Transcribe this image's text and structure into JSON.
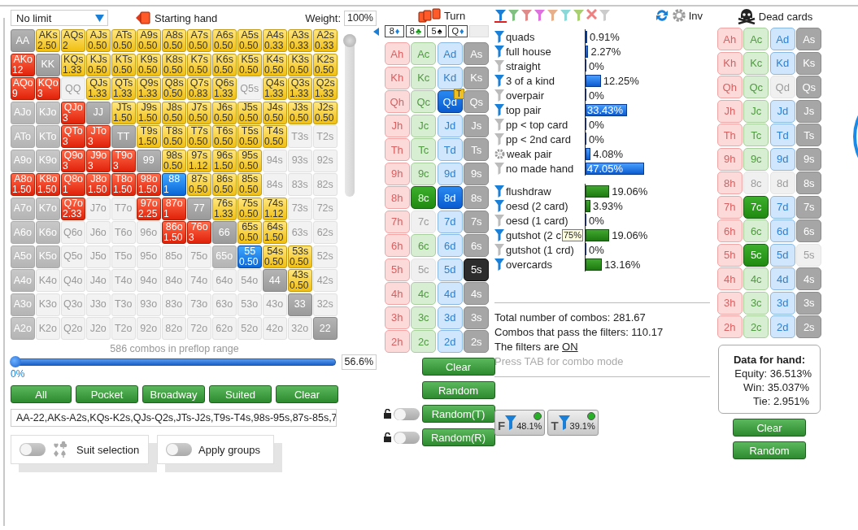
{
  "range_panel": {
    "game_dropdown": "No limit",
    "starting_hand_label": "Starting hand",
    "weight_label": "Weight:",
    "weight_value": "100%",
    "weight_slider": {
      "level": 1
    }
  },
  "matrix": {
    "rows": [
      [
        {
          "label": "AA",
          "kind": "pair"
        },
        {
          "label": "AKs",
          "weight": "2.50",
          "kind": "suited"
        },
        {
          "label": "AQs",
          "weight": "2",
          "kind": "suited"
        },
        {
          "label": "AJs",
          "weight": "0.50",
          "kind": "suited"
        },
        {
          "label": "ATs",
          "weight": "0.50",
          "kind": "suited"
        },
        {
          "label": "A9s",
          "weight": "0.50",
          "kind": "suited"
        },
        {
          "label": "A8s",
          "weight": "0.50",
          "kind": "suited"
        },
        {
          "label": "A7s",
          "weight": "0.50",
          "kind": "suited"
        },
        {
          "label": "A6s",
          "weight": "0.50",
          "kind": "suited"
        },
        {
          "label": "A5s",
          "weight": "0.50",
          "kind": "suited"
        },
        {
          "label": "A4s",
          "weight": "0.33",
          "kind": "suited"
        },
        {
          "label": "A3s",
          "weight": "0.33",
          "kind": "suited"
        },
        {
          "label": "A2s",
          "weight": "0.33",
          "kind": "suited"
        }
      ],
      [
        {
          "label": "AKo",
          "weight": "12",
          "kind": "offsuit"
        },
        {
          "label": "KK",
          "kind": "pair"
        },
        {
          "label": "KQs",
          "weight": "1.33",
          "kind": "suited"
        },
        {
          "label": "KJs",
          "weight": "0.50",
          "kind": "suited"
        },
        {
          "label": "KTs",
          "weight": "0.50",
          "kind": "suited"
        },
        {
          "label": "K9s",
          "weight": "0.50",
          "kind": "suited"
        },
        {
          "label": "K8s",
          "weight": "0.50",
          "kind": "suited"
        },
        {
          "label": "K7s",
          "weight": "0.50",
          "kind": "suited"
        },
        {
          "label": "K6s",
          "weight": "0.50",
          "kind": "suited"
        },
        {
          "label": "K5s",
          "weight": "0.50",
          "kind": "suited"
        },
        {
          "label": "K4s",
          "weight": "0.50",
          "kind": "suited"
        },
        {
          "label": "K3s",
          "weight": "0.50",
          "kind": "suited"
        },
        {
          "label": "K2s",
          "weight": "0.50",
          "kind": "suited"
        }
      ],
      [
        {
          "label": "AQo",
          "weight": "9",
          "kind": "offsuit"
        },
        {
          "label": "KQo",
          "weight": "3",
          "kind": "offsuit"
        },
        {
          "label": "QQ",
          "kind": "empty"
        },
        {
          "label": "QJs",
          "weight": "1.33",
          "kind": "suited"
        },
        {
          "label": "QTs",
          "weight": "1.33",
          "kind": "suited"
        },
        {
          "label": "Q9s",
          "weight": "1.33",
          "kind": "suited"
        },
        {
          "label": "Q8s",
          "weight": "0.50",
          "kind": "suited"
        },
        {
          "label": "Q7s",
          "weight": "0.83",
          "kind": "suited"
        },
        {
          "label": "Q6s",
          "weight": "1.33",
          "kind": "suited"
        },
        {
          "label": "Q5s",
          "kind": "empty"
        },
        {
          "label": "Q4s",
          "weight": "1.33",
          "kind": "suited"
        },
        {
          "label": "Q3s",
          "weight": "1.33",
          "kind": "suited"
        },
        {
          "label": "Q2s",
          "weight": "1.33",
          "kind": "suited"
        }
      ],
      [
        {
          "label": "AJo",
          "kind": "gray"
        },
        {
          "label": "KJo",
          "kind": "gray"
        },
        {
          "label": "QJo",
          "weight": "3",
          "kind": "offsuit"
        },
        {
          "label": "JJ",
          "kind": "pair"
        },
        {
          "label": "JTs",
          "weight": "1.50",
          "kind": "suited"
        },
        {
          "label": "J9s",
          "weight": "1.50",
          "kind": "suited"
        },
        {
          "label": "J8s",
          "weight": "0.50",
          "kind": "suited"
        },
        {
          "label": "J7s",
          "weight": "0.50",
          "kind": "suited"
        },
        {
          "label": "J6s",
          "weight": "0.50",
          "kind": "suited"
        },
        {
          "label": "J5s",
          "weight": "0.50",
          "kind": "suited"
        },
        {
          "label": "J4s",
          "weight": "0.50",
          "kind": "suited"
        },
        {
          "label": "J3s",
          "weight": "0.50",
          "kind": "suited"
        },
        {
          "label": "J2s",
          "weight": "0.50",
          "kind": "suited"
        }
      ],
      [
        {
          "label": "ATo",
          "kind": "gray"
        },
        {
          "label": "KTo",
          "kind": "gray"
        },
        {
          "label": "QTo",
          "weight": "3",
          "kind": "offsuit"
        },
        {
          "label": "JTo",
          "weight": "3",
          "kind": "offsuit"
        },
        {
          "label": "TT",
          "kind": "pair"
        },
        {
          "label": "T9s",
          "weight": "1.50",
          "kind": "suited"
        },
        {
          "label": "T8s",
          "weight": "0.50",
          "kind": "suited"
        },
        {
          "label": "T7s",
          "weight": "0.50",
          "kind": "suited"
        },
        {
          "label": "T6s",
          "weight": "0.50",
          "kind": "suited"
        },
        {
          "label": "T5s",
          "weight": "0.50",
          "kind": "suited"
        },
        {
          "label": "T4s",
          "weight": "0.50",
          "kind": "suited"
        },
        {
          "label": "T3s",
          "kind": "empty"
        },
        {
          "label": "T2s",
          "kind": "empty"
        }
      ],
      [
        {
          "label": "A9o",
          "kind": "gray"
        },
        {
          "label": "K9o",
          "kind": "gray"
        },
        {
          "label": "Q9o",
          "weight": "3",
          "kind": "offsuit"
        },
        {
          "label": "J9o",
          "weight": "3",
          "kind": "offsuit"
        },
        {
          "label": "T9o",
          "weight": "3",
          "kind": "offsuit"
        },
        {
          "label": "99",
          "kind": "pair"
        },
        {
          "label": "98s",
          "weight": "0.50",
          "kind": "suited"
        },
        {
          "label": "97s",
          "weight": "1.12",
          "kind": "suited"
        },
        {
          "label": "96s",
          "weight": "1.50",
          "kind": "suited"
        },
        {
          "label": "95s",
          "weight": "0.50",
          "kind": "suited"
        },
        {
          "label": "94s",
          "kind": "empty"
        },
        {
          "label": "93s",
          "kind": "empty"
        },
        {
          "label": "92s",
          "kind": "empty"
        }
      ],
      [
        {
          "label": "A8o",
          "weight": "1.50",
          "kind": "offsuit"
        },
        {
          "label": "K8o",
          "weight": "1.50",
          "kind": "offsuit"
        },
        {
          "label": "Q8o",
          "weight": "1",
          "kind": "offsuit"
        },
        {
          "label": "J8o",
          "weight": "1.50",
          "kind": "offsuit"
        },
        {
          "label": "T8o",
          "weight": "1.50",
          "kind": "offsuit"
        },
        {
          "label": "98o",
          "weight": "1.50",
          "kind": "offsuit"
        },
        {
          "label": "88",
          "weight": "1",
          "kind": "blue"
        },
        {
          "label": "87s",
          "weight": "0.50",
          "kind": "suited"
        },
        {
          "label": "86s",
          "weight": "0.50",
          "kind": "suited"
        },
        {
          "label": "85s",
          "weight": "0.50",
          "kind": "suited"
        },
        {
          "label": "84s",
          "kind": "empty"
        },
        {
          "label": "83s",
          "kind": "empty"
        },
        {
          "label": "82s",
          "kind": "empty"
        }
      ],
      [
        {
          "label": "A7o",
          "kind": "gray"
        },
        {
          "label": "K7o",
          "kind": "gray"
        },
        {
          "label": "Q7o",
          "weight": "2.33",
          "kind": "offsuit"
        },
        {
          "label": "J7o",
          "kind": "empty"
        },
        {
          "label": "T7o",
          "kind": "empty"
        },
        {
          "label": "97o",
          "weight": "2.25",
          "kind": "offsuit"
        },
        {
          "label": "87o",
          "weight": "1",
          "kind": "offsuit"
        },
        {
          "label": "77",
          "kind": "pair"
        },
        {
          "label": "76s",
          "weight": "1.33",
          "kind": "suited"
        },
        {
          "label": "75s",
          "weight": "0.50",
          "kind": "suited"
        },
        {
          "label": "74s",
          "weight": "1.12",
          "kind": "suited"
        },
        {
          "label": "73s",
          "kind": "empty"
        },
        {
          "label": "72s",
          "kind": "empty"
        }
      ],
      [
        {
          "label": "A6o",
          "kind": "gray"
        },
        {
          "label": "K6o",
          "kind": "gray"
        },
        {
          "label": "Q6o",
          "kind": "empty"
        },
        {
          "label": "J6o",
          "kind": "empty"
        },
        {
          "label": "T6o",
          "kind": "empty"
        },
        {
          "label": "96o",
          "kind": "empty"
        },
        {
          "label": "86o",
          "weight": "1.50",
          "kind": "offsuit"
        },
        {
          "label": "76o",
          "weight": "3",
          "kind": "offsuit"
        },
        {
          "label": "66",
          "kind": "pair"
        },
        {
          "label": "65s",
          "weight": "0.50",
          "kind": "suited"
        },
        {
          "label": "64s",
          "weight": "1.50",
          "kind": "suited"
        },
        {
          "label": "63s",
          "kind": "empty"
        },
        {
          "label": "62s",
          "kind": "empty"
        }
      ],
      [
        {
          "label": "A5o",
          "kind": "gray"
        },
        {
          "label": "K5o",
          "kind": "gray"
        },
        {
          "label": "Q5o",
          "kind": "empty"
        },
        {
          "label": "J5o",
          "kind": "empty"
        },
        {
          "label": "T5o",
          "kind": "empty"
        },
        {
          "label": "95o",
          "kind": "empty"
        },
        {
          "label": "85o",
          "kind": "empty"
        },
        {
          "label": "75o",
          "kind": "empty"
        },
        {
          "label": "65o",
          "kind": "gray"
        },
        {
          "label": "55",
          "weight": "0.50",
          "kind": "blue"
        },
        {
          "label": "54s",
          "weight": "0.50",
          "kind": "suited"
        },
        {
          "label": "53s",
          "weight": "0.50",
          "kind": "suited"
        },
        {
          "label": "52s",
          "kind": "empty"
        }
      ],
      [
        {
          "label": "A4o",
          "kind": "gray"
        },
        {
          "label": "K4o",
          "kind": "empty"
        },
        {
          "label": "Q4o",
          "kind": "empty"
        },
        {
          "label": "J4o",
          "kind": "empty"
        },
        {
          "label": "T4o",
          "kind": "empty"
        },
        {
          "label": "94o",
          "kind": "empty"
        },
        {
          "label": "84o",
          "kind": "empty"
        },
        {
          "label": "74o",
          "kind": "empty"
        },
        {
          "label": "64o",
          "kind": "empty"
        },
        {
          "label": "54o",
          "kind": "empty"
        },
        {
          "label": "44",
          "kind": "pair"
        },
        {
          "label": "43s",
          "weight": "0.50",
          "kind": "suited"
        },
        {
          "label": "42s",
          "kind": "empty"
        }
      ],
      [
        {
          "label": "A3o",
          "kind": "gray"
        },
        {
          "label": "K3o",
          "kind": "empty"
        },
        {
          "label": "Q3o",
          "kind": "empty"
        },
        {
          "label": "J3o",
          "kind": "empty"
        },
        {
          "label": "T3o",
          "kind": "empty"
        },
        {
          "label": "93o",
          "kind": "empty"
        },
        {
          "label": "83o",
          "kind": "empty"
        },
        {
          "label": "73o",
          "kind": "empty"
        },
        {
          "label": "63o",
          "kind": "empty"
        },
        {
          "label": "53o",
          "kind": "empty"
        },
        {
          "label": "43o",
          "kind": "empty"
        },
        {
          "label": "33",
          "kind": "pair"
        },
        {
          "label": "32s",
          "kind": "empty"
        }
      ],
      [
        {
          "label": "A2o",
          "kind": "gray"
        },
        {
          "label": "K2o",
          "kind": "empty"
        },
        {
          "label": "Q2o",
          "kind": "empty"
        },
        {
          "label": "J2o",
          "kind": "empty"
        },
        {
          "label": "T2o",
          "kind": "empty"
        },
        {
          "label": "92o",
          "kind": "empty"
        },
        {
          "label": "82o",
          "kind": "empty"
        },
        {
          "label": "72o",
          "kind": "empty"
        },
        {
          "label": "62o",
          "kind": "empty"
        },
        {
          "label": "52o",
          "kind": "empty"
        },
        {
          "label": "42o",
          "kind": "empty"
        },
        {
          "label": "32o",
          "kind": "empty"
        },
        {
          "label": "22",
          "kind": "pair"
        }
      ]
    ]
  },
  "range_footer": {
    "combos_text": "586 combos in preflop range",
    "range_slider": {
      "level": 0
    },
    "slider_min": "0%",
    "slider_value": "56.6%",
    "buttons": [
      "All",
      "Pocket",
      "Broadway",
      "Suited",
      "Clear"
    ],
    "range_text": "AA-22,AKs-A2s,KQs-K2s,QJs-Q2s,JTs-J2s,T9s-T4s,98s-95s,87s-85s,7",
    "toggles": [
      {
        "label": "Suit selection",
        "on": false,
        "kind": "suits"
      },
      {
        "label": "Apply groups",
        "on": false,
        "kind": "plain"
      }
    ]
  },
  "board": {
    "title": "Turn",
    "slots": [
      {
        "kind": "card",
        "rank": "8",
        "suit": "♦",
        "color": "#1a7fd6"
      },
      {
        "kind": "card",
        "rank": "8",
        "suit": "♣",
        "color": "#1a9a1a"
      },
      {
        "kind": "card",
        "rank": "5",
        "suit": "♠",
        "color": "#111111"
      },
      {
        "kind": "card",
        "rank": "Q",
        "suit": "♦",
        "color": "#1a7fd6"
      },
      {
        "kind": "empty"
      }
    ],
    "cards": [
      [
        {
          "label": "Ah",
          "kind": "normal"
        },
        {
          "label": "Ac",
          "kind": "normal"
        },
        {
          "label": "Ad",
          "kind": "normal"
        },
        {
          "label": "As",
          "kind": "normal"
        }
      ],
      [
        {
          "label": "Kh",
          "kind": "normal"
        },
        {
          "label": "Kc",
          "kind": "normal"
        },
        {
          "label": "Kd",
          "kind": "normal"
        },
        {
          "label": "Ks",
          "kind": "normal"
        }
      ],
      [
        {
          "label": "Qh",
          "kind": "normal"
        },
        {
          "label": "Qc",
          "kind": "normal"
        },
        {
          "label": "Qd",
          "kind": "selected",
          "badge": "T"
        },
        {
          "label": "Qs",
          "kind": "normal"
        }
      ],
      [
        {
          "label": "Jh",
          "kind": "normal"
        },
        {
          "label": "Jc",
          "kind": "normal"
        },
        {
          "label": "Jd",
          "kind": "normal"
        },
        {
          "label": "Js",
          "kind": "normal"
        }
      ],
      [
        {
          "label": "Th",
          "kind": "normal"
        },
        {
          "label": "Tc",
          "kind": "normal"
        },
        {
          "label": "Td",
          "kind": "normal"
        },
        {
          "label": "Ts",
          "kind": "normal"
        }
      ],
      [
        {
          "label": "9h",
          "kind": "normal"
        },
        {
          "label": "9c",
          "kind": "normal"
        },
        {
          "label": "9d",
          "kind": "normal"
        },
        {
          "label": "9s",
          "kind": "normal"
        }
      ],
      [
        {
          "label": "8h",
          "kind": "normal"
        },
        {
          "label": "8c",
          "kind": "selected"
        },
        {
          "label": "8d",
          "kind": "selected"
        },
        {
          "label": "8s",
          "kind": "normal"
        }
      ],
      [
        {
          "label": "7h",
          "kind": "normal"
        },
        {
          "label": "7c",
          "kind": "used"
        },
        {
          "label": "7d",
          "kind": "normal"
        },
        {
          "label": "7s",
          "kind": "normal"
        }
      ],
      [
        {
          "label": "6h",
          "kind": "normal"
        },
        {
          "label": "6c",
          "kind": "normal"
        },
        {
          "label": "6d",
          "kind": "normal"
        },
        {
          "label": "6s",
          "kind": "normal"
        }
      ],
      [
        {
          "label": "5h",
          "kind": "normal"
        },
        {
          "label": "5c",
          "kind": "used"
        },
        {
          "label": "5d",
          "kind": "normal"
        },
        {
          "label": "5s",
          "kind": "selected"
        }
      ],
      [
        {
          "label": "4h",
          "kind": "normal"
        },
        {
          "label": "4c",
          "kind": "normal"
        },
        {
          "label": "4d",
          "kind": "normal"
        },
        {
          "label": "4s",
          "kind": "normal"
        }
      ],
      [
        {
          "label": "3h",
          "kind": "normal"
        },
        {
          "label": "3c",
          "kind": "normal"
        },
        {
          "label": "3d",
          "kind": "normal"
        },
        {
          "label": "3s",
          "kind": "normal"
        }
      ],
      [
        {
          "label": "2h",
          "kind": "normal"
        },
        {
          "label": "2c",
          "kind": "normal"
        },
        {
          "label": "2d",
          "kind": "normal"
        },
        {
          "label": "2s",
          "kind": "normal"
        }
      ]
    ],
    "buttons": [
      {
        "label": "Clear",
        "kind": "plain"
      },
      {
        "label": "Random",
        "kind": "plain"
      },
      {
        "label": "Random(T)",
        "kind": "lock",
        "on": false
      },
      {
        "label": "Random(R)",
        "kind": "lock",
        "on": false
      }
    ]
  },
  "stats": {
    "filter_tabs": [
      {
        "kind": "funnel",
        "color": "#1a7fd6",
        "selected": true
      },
      {
        "kind": "funnel",
        "color": "#80c080",
        "selected": false
      },
      {
        "kind": "funnel",
        "color": "#e08a8a",
        "selected": false
      },
      {
        "kind": "funnel",
        "color": "#e070e0",
        "selected": false
      },
      {
        "kind": "funnel",
        "color": "#e8b08a",
        "selected": false
      },
      {
        "kind": "funnel",
        "color": "#8ad8d8",
        "selected": false
      },
      {
        "kind": "funnel",
        "color": "#a8d070",
        "selected": false
      },
      {
        "kind": "clear",
        "color": "#f08080",
        "selected": false
      },
      {
        "kind": "funnel",
        "color": "#cccccc",
        "selected": false
      }
    ],
    "inv_label": "Inv",
    "made_hands": [
      {
        "kind": "filter",
        "on": true,
        "label": "quads",
        "level": 0.0091,
        "reading": "0.91%"
      },
      {
        "kind": "filter",
        "on": true,
        "label": "full house",
        "level": 0.0227,
        "reading": "2.27%"
      },
      {
        "kind": "filter",
        "on": false,
        "label": "straight",
        "level": 0,
        "reading": "0%"
      },
      {
        "kind": "filter",
        "on": true,
        "label": "3 of a kind",
        "level": 0.1225,
        "reading": "12.25%"
      },
      {
        "kind": "filter",
        "on": false,
        "label": "overpair",
        "level": 0,
        "reading": "0%"
      },
      {
        "kind": "filter",
        "on": true,
        "label": "top pair",
        "level": 0.3343,
        "reading": "33.43%"
      },
      {
        "kind": "filter",
        "on": false,
        "label": "pp < top card",
        "level": 0,
        "reading": "0%"
      },
      {
        "kind": "filter",
        "on": false,
        "label": "pp < 2nd card",
        "level": 0,
        "reading": "0%"
      },
      {
        "kind": "settings",
        "label": "weak pair",
        "level": 0.0408,
        "reading": "4.08%"
      },
      {
        "kind": "filter",
        "on": false,
        "label": "no made hand",
        "level": 0.4705,
        "reading": "47.05%"
      }
    ],
    "draws": [
      {
        "kind": "filter",
        "on": true,
        "label": "flushdraw",
        "level": 0.1906,
        "reading": "19.06%"
      },
      {
        "kind": "filter",
        "on": true,
        "label": "oesd (2 card)",
        "level": 0.0393,
        "reading": "3.93%"
      },
      {
        "kind": "filter",
        "on": false,
        "label": "oesd (1 card)",
        "level": 0,
        "reading": "0%"
      },
      {
        "kind": "filter",
        "on": true,
        "label": "gutshot (2 c",
        "tooltip": "75%",
        "level": 0.1906,
        "reading": "19.06%"
      },
      {
        "kind": "filter",
        "on": false,
        "label": "gutshot (1 crd)",
        "level": 0,
        "reading": "0%"
      },
      {
        "kind": "filter",
        "on": true,
        "label": "overcards",
        "level": 0.1316,
        "reading": "13.16%"
      }
    ],
    "total_combos": "Total number of combos: 281.67",
    "passing_combos": "Combos that pass the filters: 110.17",
    "filters_text": "The filters are",
    "filters_link": "ON",
    "hint": "Press TAB for combo mode",
    "badges": [
      {
        "letter": "F",
        "value": "48.1%",
        "on": true
      },
      {
        "letter": "T",
        "value": "39.1%",
        "on": true
      }
    ]
  },
  "dead_cards": {
    "title": "Dead cards",
    "cards": [
      [
        {
          "label": "Ah",
          "kind": "normal"
        },
        {
          "label": "Ac",
          "kind": "normal"
        },
        {
          "label": "Ad",
          "kind": "normal"
        },
        {
          "label": "As",
          "kind": "normal"
        }
      ],
      [
        {
          "label": "Kh",
          "kind": "normal"
        },
        {
          "label": "Kc",
          "kind": "normal"
        },
        {
          "label": "Kd",
          "kind": "normal"
        },
        {
          "label": "Ks",
          "kind": "normal"
        }
      ],
      [
        {
          "label": "Qh",
          "kind": "normal"
        },
        {
          "label": "Qc",
          "kind": "normal"
        },
        {
          "label": "Qd",
          "kind": "used"
        },
        {
          "label": "Qs",
          "kind": "normal"
        }
      ],
      [
        {
          "label": "Jh",
          "kind": "normal"
        },
        {
          "label": "Jc",
          "kind": "normal"
        },
        {
          "label": "Jd",
          "kind": "normal"
        },
        {
          "label": "Js",
          "kind": "normal"
        }
      ],
      [
        {
          "label": "Th",
          "kind": "normal"
        },
        {
          "label": "Tc",
          "kind": "normal"
        },
        {
          "label": "Td",
          "kind": "normal"
        },
        {
          "label": "Ts",
          "kind": "normal"
        }
      ],
      [
        {
          "label": "9h",
          "kind": "normal"
        },
        {
          "label": "9c",
          "kind": "normal"
        },
        {
          "label": "9d",
          "kind": "normal"
        },
        {
          "label": "9s",
          "kind": "normal"
        }
      ],
      [
        {
          "label": "8h",
          "kind": "normal"
        },
        {
          "label": "8c",
          "kind": "used"
        },
        {
          "label": "8d",
          "kind": "used"
        },
        {
          "label": "8s",
          "kind": "normal"
        }
      ],
      [
        {
          "label": "7h",
          "kind": "normal"
        },
        {
          "label": "7c",
          "kind": "selected"
        },
        {
          "label": "7d",
          "kind": "normal"
        },
        {
          "label": "7s",
          "kind": "normal"
        }
      ],
      [
        {
          "label": "6h",
          "kind": "normal"
        },
        {
          "label": "6c",
          "kind": "normal"
        },
        {
          "label": "6d",
          "kind": "normal"
        },
        {
          "label": "6s",
          "kind": "normal"
        }
      ],
      [
        {
          "label": "5h",
          "kind": "normal"
        },
        {
          "label": "5c",
          "kind": "selected"
        },
        {
          "label": "5d",
          "kind": "normal"
        },
        {
          "label": "5s",
          "kind": "used"
        }
      ],
      [
        {
          "label": "4h",
          "kind": "normal"
        },
        {
          "label": "4c",
          "kind": "normal"
        },
        {
          "label": "4d",
          "kind": "normal"
        },
        {
          "label": "4s",
          "kind": "normal"
        }
      ],
      [
        {
          "label": "3h",
          "kind": "normal"
        },
        {
          "label": "3c",
          "kind": "normal"
        },
        {
          "label": "3d",
          "kind": "normal"
        },
        {
          "label": "3s",
          "kind": "normal"
        }
      ],
      [
        {
          "label": "2h",
          "kind": "normal"
        },
        {
          "label": "2c",
          "kind": "normal"
        },
        {
          "label": "2d",
          "kind": "normal"
        },
        {
          "label": "2s",
          "kind": "normal"
        }
      ]
    ],
    "data_box": {
      "title": "Data for hand:",
      "lines": [
        "Equity: 36.513%",
        "Win: 35.037%",
        "Tie: 2.951%"
      ]
    },
    "buttons": [
      "Clear",
      "Random"
    ]
  }
}
